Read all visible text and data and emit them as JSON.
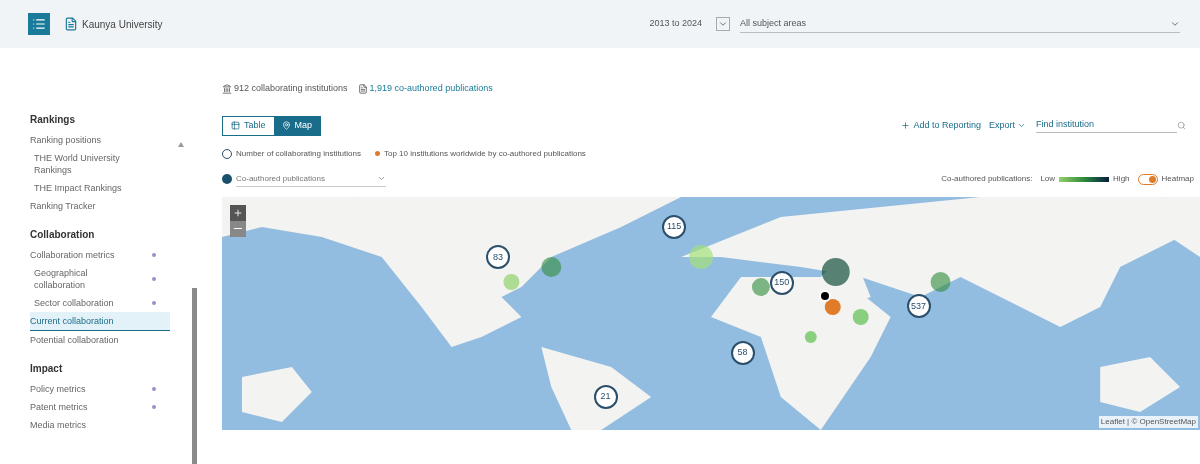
{
  "header": {
    "institution": "Kaunya University",
    "year_range": "2013 to 2024",
    "subject_filter": "All subject areas"
  },
  "summary": {
    "institutions": "912 collaborating institutions",
    "publications": "1,919 co-authored publications"
  },
  "sidebar": {
    "sections": [
      {
        "title": "Rankings",
        "items": [
          {
            "label": "Ranking positions",
            "sub": false,
            "expandable": false,
            "selected": false
          },
          {
            "label": "THE World University Rankings",
            "sub": true,
            "expandable": false,
            "selected": false
          },
          {
            "label": "THE Impact Rankings",
            "sub": true,
            "expandable": false,
            "selected": false
          },
          {
            "label": "Ranking Tracker",
            "sub": false,
            "expandable": false,
            "selected": false
          }
        ]
      },
      {
        "title": "Collaboration",
        "items": [
          {
            "label": "Collaboration metrics",
            "sub": false,
            "expandable": true,
            "selected": false
          },
          {
            "label": "Geographical collaboration",
            "sub": true,
            "expandable": true,
            "selected": false
          },
          {
            "label": "Sector collaboration",
            "sub": true,
            "expandable": true,
            "selected": false
          },
          {
            "label": "Current collaboration",
            "sub": false,
            "expandable": false,
            "selected": true
          },
          {
            "label": "Potential collaboration",
            "sub": false,
            "expandable": false,
            "selected": false
          }
        ]
      },
      {
        "title": "Impact",
        "items": [
          {
            "label": "Policy metrics",
            "sub": false,
            "expandable": true,
            "selected": false
          },
          {
            "label": "Patent metrics",
            "sub": false,
            "expandable": true,
            "selected": false
          },
          {
            "label": "Media metrics",
            "sub": false,
            "expandable": false,
            "selected": false
          }
        ]
      }
    ]
  },
  "view_tabs": [
    {
      "label": "Table",
      "selected": false
    },
    {
      "label": "Map",
      "selected": true
    }
  ],
  "actions": {
    "add": "Add to Reporting",
    "export": "Export",
    "search_placeholder": "Find institution"
  },
  "legend": {
    "count_marker": "Number of collaborating institutions",
    "top_marker": "Top 10 institutions worldwide by co-authored publications"
  },
  "metric_select": "Co-authored publications",
  "scale": {
    "label": "Co-authored publications:",
    "low": "Low",
    "high": "High"
  },
  "heatmap": {
    "label": "Heatmap",
    "on": true
  },
  "map": {
    "clusters": [
      "115",
      "83",
      "150",
      "537",
      "58",
      "21"
    ],
    "attribution": "Leaflet | © OpenStreetMap"
  }
}
